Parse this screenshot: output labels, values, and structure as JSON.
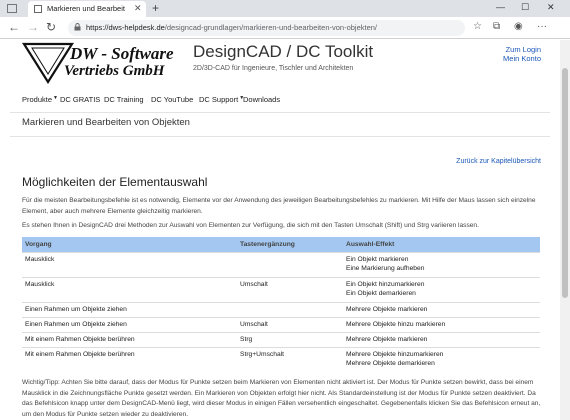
{
  "browser": {
    "tab_title": "Markieren und Bearbeit",
    "url_host": "https://dws-helpdesk.de",
    "url_path": "/designcad-grundlagen/markieren-und-bearbeiten-von-objekten/",
    "icons": [
      "back-icon",
      "forward-icon",
      "reload-icon",
      "lock-icon",
      "favorite-icon",
      "collections-icon",
      "profile-icon",
      "more-icon"
    ]
  },
  "header": {
    "logo_line1": "DW - Software",
    "logo_line2": "Vertriebs GmbH",
    "title": "DesignCAD / DC Toolkit",
    "subtitle": "2D/3D-CAD für Ingenieure, Tischler und Architekten",
    "login": "Zum Login",
    "account": "Mein Konto"
  },
  "nav": {
    "items": [
      "Produkte",
      "DC GRATIS",
      "DC Training",
      "DC YouTube",
      "DC Support",
      "Downloads"
    ]
  },
  "page": {
    "heading": "Markieren und Bearbeiten von Objekten",
    "back_link": "Zurück zur Kapitelübersicht",
    "section_title": "Möglichkeiten der Elementauswahl",
    "para1": "Für die meisten Bearbeitungsbefehle ist es notwendig, Elemente vor der Anwendung des jeweiligen Bearbeitungsbefehles zu markieren. Mit Hilfe der Maus lassen sich einzelne Element, aber auch mehrere Elemente gleichzeitig markieren.",
    "para2": "Es stehen Ihnen in DesignCAD drei Methoden zur Auswahl von Elementen zur Verfügung, die sich mit den Tasten Umschalt (Shift) und Strg variieren lassen.",
    "tip": "Wichtig/Tipp: Achten Sie bitte darauf, dass der Modus für Punkte setzen beim Markieren von Elementen nicht aktiviert ist. Der Modus für Punkte setzen bewirkt, dass bei einem Mausklick in die Zeichnungsfläche Punkte gesetzt werden. Ein Markieren von Objekten erfolgt hier nicht. Als Standardeinstellung ist der Modus für Punkte setzen deaktiviert. Da das Befehlsicon knapp unter dem DesignCAD-Menü liegt, wird dieser Modus in einigen Fällen versehentlich eingeschaltet. Gegebenenfalls klicken Sie das Befehlsicon erneut an, um den Modus für Punkte setzen wieder zu deaktivieren."
  },
  "table": {
    "headers": [
      "Vorgang",
      "Tastenergänzung",
      "Auswahl-Effekt"
    ],
    "rows": [
      {
        "vorgang": "Mausklick",
        "taste": "",
        "effekt": [
          "Ein Objekt markieren",
          "Eine Markierung aufheben"
        ]
      },
      {
        "vorgang": "Mausklick",
        "taste": "Umschalt",
        "effekt": [
          "Ein Objekt hinzumarkieren",
          "Ein Objekt demarkieren"
        ]
      },
      {
        "vorgang": "Einen Rahmen um Objekte ziehen",
        "taste": "",
        "effekt": [
          "Mehrere Objekte markieren"
        ]
      },
      {
        "vorgang": "Einen Rahmen um Objekte ziehen",
        "taste": "Umschalt",
        "effekt": [
          "Mehrere Objekte hinzu markieren"
        ]
      },
      {
        "vorgang": "Mit einem Rahmen Objekte berühren",
        "taste": "Strg",
        "effekt": [
          "Mehrere Objekte markieren"
        ]
      },
      {
        "vorgang": "Mit einem Rahmen Objekte berühren",
        "taste": "Strg+Umschalt",
        "effekt": [
          "Mehrere Objekte hinzumarkieren",
          "Mehrere Objekte demarkieren"
        ]
      }
    ]
  },
  "colors": {
    "table_header_bg": "#a3c7f0",
    "link": "#1b58b8"
  }
}
